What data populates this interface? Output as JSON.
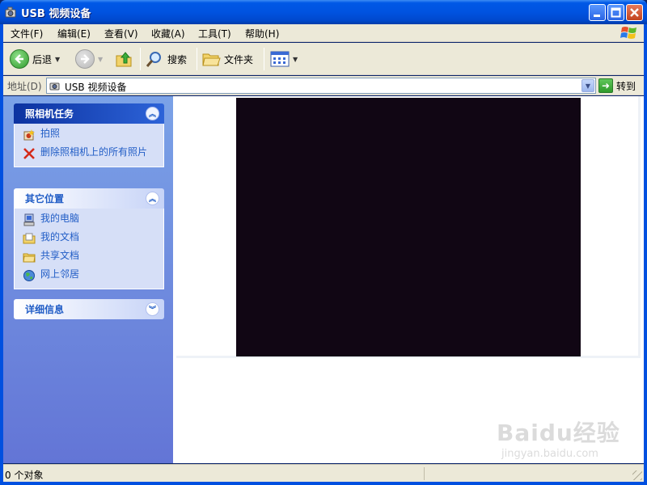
{
  "window": {
    "title": "USB 视频设备"
  },
  "menubar": {
    "items": [
      "文件(F)",
      "编辑(E)",
      "查看(V)",
      "收藏(A)",
      "工具(T)",
      "帮助(H)"
    ]
  },
  "toolbar": {
    "back_label": "后退",
    "search_label": "搜索",
    "folders_label": "文件夹"
  },
  "address": {
    "label": "地址(D)",
    "value": "USB 视频设备",
    "go_label": "转到"
  },
  "taskpane": {
    "camera_tasks": {
      "title": "照相机任务",
      "items": [
        "拍照",
        "删除照相机上的所有照片"
      ]
    },
    "other_places": {
      "title": "其它位置",
      "items": [
        "我的电脑",
        "我的文档",
        "共享文档",
        "网上邻居"
      ]
    },
    "details": {
      "title": "详细信息"
    }
  },
  "watermark": {
    "brand": "Baidu经验",
    "url": "jingyan.baidu.com"
  },
  "statusbar": {
    "text": "0 个对象"
  },
  "colors": {
    "titlebar": "#0053e0",
    "chrome": "#ece9d8",
    "taskpane": "#6f8ee0",
    "link": "#215dc6",
    "video": "#110614"
  }
}
